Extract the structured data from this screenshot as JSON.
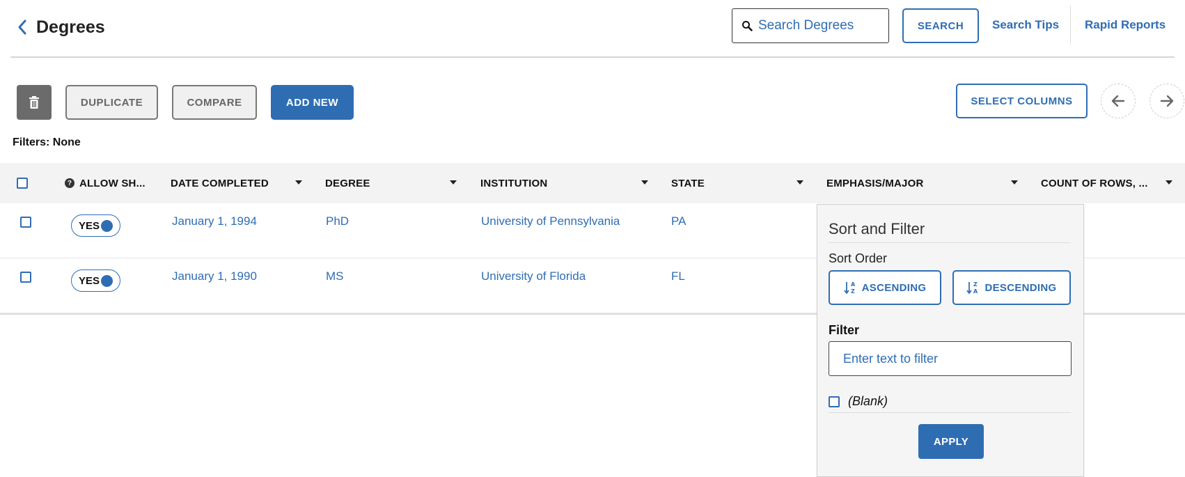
{
  "header": {
    "title": "Degrees",
    "search_placeholder": "Search Degrees",
    "search_button": "SEARCH",
    "search_tips": "Search Tips",
    "rapid_reports": "Rapid Reports"
  },
  "toolbar": {
    "duplicate": "DUPLICATE",
    "compare": "COMPARE",
    "add_new": "ADD NEW",
    "select_columns": "SELECT COLUMNS"
  },
  "filters_text": "Filters: None",
  "table": {
    "columns": [
      "ALLOW SH...",
      "DATE COMPLETED",
      "DEGREE",
      "INSTITUTION",
      "STATE",
      "EMPHASIS/MAJOR",
      "COUNT OF ROWS, ..."
    ],
    "rows": [
      {
        "allow": "YES",
        "date": "January 1, 1994",
        "degree": "PhD",
        "institution": "University of Pennsylvania",
        "state": "PA"
      },
      {
        "allow": "YES",
        "date": "January 1, 1990",
        "degree": "MS",
        "institution": "University of Florida",
        "state": "FL"
      }
    ]
  },
  "popup": {
    "title": "Sort and Filter",
    "sort_order_label": "Sort Order",
    "ascending": "ASCENDING",
    "descending": "DESCENDING",
    "filter_label": "Filter",
    "filter_placeholder": "Enter text to filter",
    "blank_option": "(Blank)",
    "apply": "APPLY"
  },
  "icons": {
    "back": "chevron-left-icon",
    "search": "search-icon",
    "trash": "trash-icon",
    "prev": "arrow-left-icon",
    "next": "arrow-right-icon",
    "help": "help-icon",
    "sort_asc": "sort-ascending-icon",
    "sort_desc": "sort-descending-icon"
  },
  "colors": {
    "accent": "#2f6db3",
    "trash_bg": "#6b6b6b",
    "header_bg": "#f3f3f4",
    "popup_bg": "#f5f5f5"
  }
}
